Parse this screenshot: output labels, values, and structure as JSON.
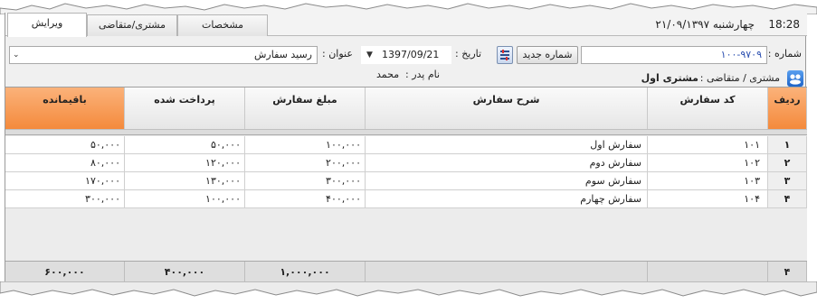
{
  "tabs": [
    {
      "label": "ویرایش",
      "active": true
    },
    {
      "label": "مشتری/متقاضی",
      "active": false
    },
    {
      "label": "مشخصات",
      "active": false
    }
  ],
  "status": {
    "date": "چهارشنبه ۲۱/۰۹/۱۳۹۷",
    "time": "18:28"
  },
  "form": {
    "number_label": "شماره :",
    "number_value": "۱۰۰-۹۷۰۹",
    "new_number_button": "شماره جدید",
    "date_label": "تاریخ :",
    "date_value": "1397/09/21",
    "title_label": "عنوان :",
    "title_value": "رسید سفارش"
  },
  "customer": {
    "label": "مشتری / متقاضی :",
    "name": "مشتری اول",
    "father_label": "نام پدر :",
    "father_name": "محمد"
  },
  "grid": {
    "columns": [
      "ردیف",
      "کد سفارش",
      "شرح سفارش",
      "مبلغ سفارش",
      "پرداخت شده",
      "باقیمانده"
    ],
    "rows": [
      {
        "index": "۱",
        "code": "۱۰۱",
        "desc": "سفارش اول",
        "amount": "۱۰۰,۰۰۰",
        "paid": "۵۰,۰۰۰",
        "remain": "۵۰,۰۰۰"
      },
      {
        "index": "۲",
        "code": "۱۰۲",
        "desc": "سفارش دوم",
        "amount": "۲۰۰,۰۰۰",
        "paid": "۱۲۰,۰۰۰",
        "remain": "۸۰,۰۰۰"
      },
      {
        "index": "۳",
        "code": "۱۰۳",
        "desc": "سفارش سوم",
        "amount": "۳۰۰,۰۰۰",
        "paid": "۱۳۰,۰۰۰",
        "remain": "۱۷۰,۰۰۰"
      },
      {
        "index": "۴",
        "code": "۱۰۴",
        "desc": "سفارش چهارم",
        "amount": "۴۰۰,۰۰۰",
        "paid": "۱۰۰,۰۰۰",
        "remain": "۳۰۰,۰۰۰"
      }
    ],
    "totals": {
      "count": "۴",
      "amount": "۱,۰۰۰,۰۰۰",
      "paid": "۴۰۰,۰۰۰",
      "remain": "۶۰۰,۰۰۰"
    }
  },
  "colors": {
    "accent_header": "#f48a3c",
    "icon_blue": "#1e64c8"
  }
}
